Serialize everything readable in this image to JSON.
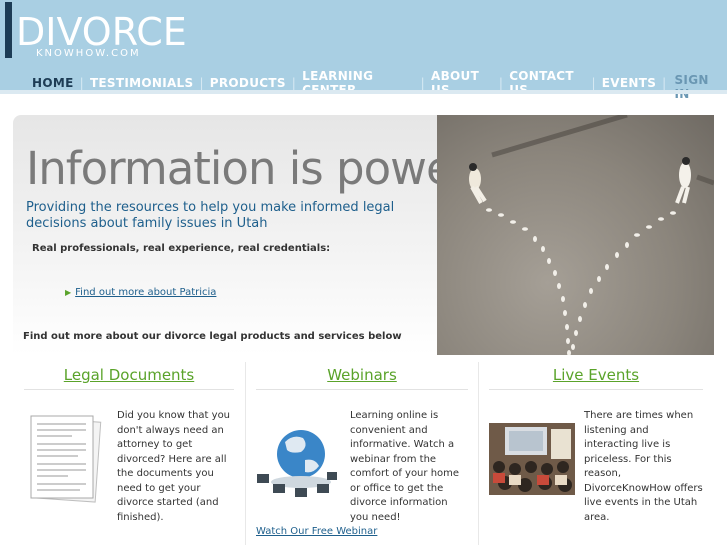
{
  "logo": {
    "main": "DIVORCE",
    "sub": "KNOWHOW.COM"
  },
  "nav": {
    "items": [
      "HOME",
      "TESTIMONIALS",
      "PRODUCTS",
      "LEARNING CENTER",
      "ABOUT US",
      "CONTACT US",
      "EVENTS"
    ],
    "signin": "SIGN IN"
  },
  "hero": {
    "title": "Information is power.",
    "subtitle": "Providing the resources to help you make informed legal decisions about family issues in Utah",
    "credentials": "Real  professionals, real experience, real credentials:",
    "link": "Find out more about Patricia",
    "find_more": "Find out more about our divorce legal products and services below"
  },
  "columns": {
    "legal": {
      "title": "Legal Documents",
      "text": "Did you know that you don't always need an attorney to get divorced?  Here are all the documents you need to get your divorce started (and finished)."
    },
    "webinars": {
      "title": "Webinars",
      "text": "Learning online is convenient and informative. Watch a webinar from the comfort of your home or office to get the divorce information you need!",
      "link": "Watch Our Free Webinar"
    },
    "events": {
      "title": "Live Events",
      "text": "There are times when listening and interacting live is priceless. For this reason, DivorceKnowHow offers live events in the Utah area."
    }
  },
  "colors": {
    "header": "#a9cfe3",
    "accent_green": "#5aa32a",
    "link_blue": "#1e5f8c"
  }
}
